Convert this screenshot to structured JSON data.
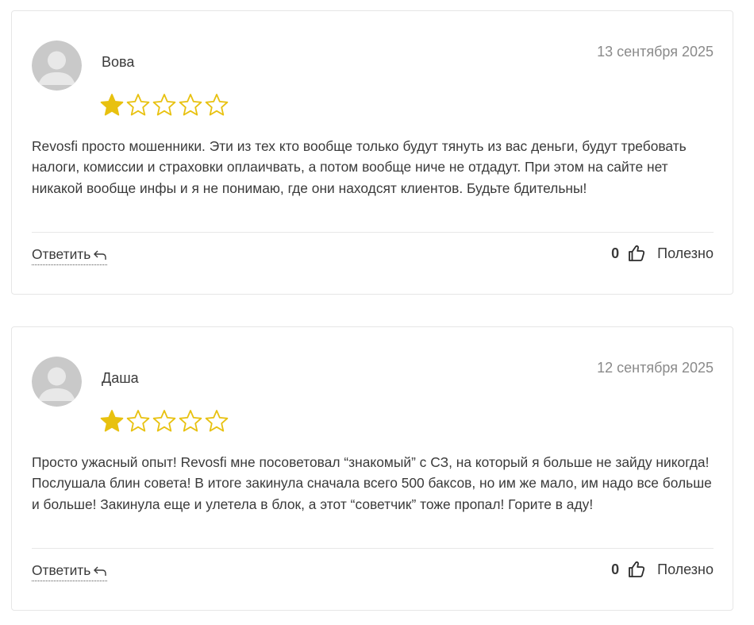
{
  "reviews": [
    {
      "author": "Вова",
      "date": "13 сентября 2025",
      "rating": 1,
      "rating_max": 5,
      "text": "Revosfi просто мошенники. Эти из тех кто вообще только будут тянуть из вас деньги, будут требовать налоги, комиссии и страховки оплаичвать, а потом вообще ниче не отдадут. При этом на сайте нет никакой вообще инфы и я не понимаю, где они находсят клиентов. Будьте бдительны!",
      "reply_label": "Ответить",
      "useful_count": "0",
      "useful_label": "Полезно"
    },
    {
      "author": "Даша",
      "date": "12 сентября 2025",
      "rating": 1,
      "rating_max": 5,
      "text": "Просто ужасный опыт! Revosfi мне посоветовал “знакомый” с СЗ, на который я больше не зайду никогда! Послушала блин совета! В итоге закинула сначала всего 500 баксов, но им же мало, им надо все больше и больше! Закинула еще и улетела в блок, а этот “советчик” тоже пропал! Горите в аду!",
      "reply_label": "Ответить",
      "useful_count": "0",
      "useful_label": "Полезно"
    }
  ],
  "colors": {
    "star_filled": "#e8c10f",
    "star_outline": "#e8c10f",
    "avatar_bg": "#c9c9c9",
    "avatar_fg": "#e6e6e6"
  },
  "icons": {
    "avatar": "user-avatar-placeholder-icon",
    "star_filled": "star-filled-icon",
    "star_empty": "star-outline-icon",
    "reply": "reply-arrow-icon",
    "useful": "thumbs-up-icon"
  }
}
